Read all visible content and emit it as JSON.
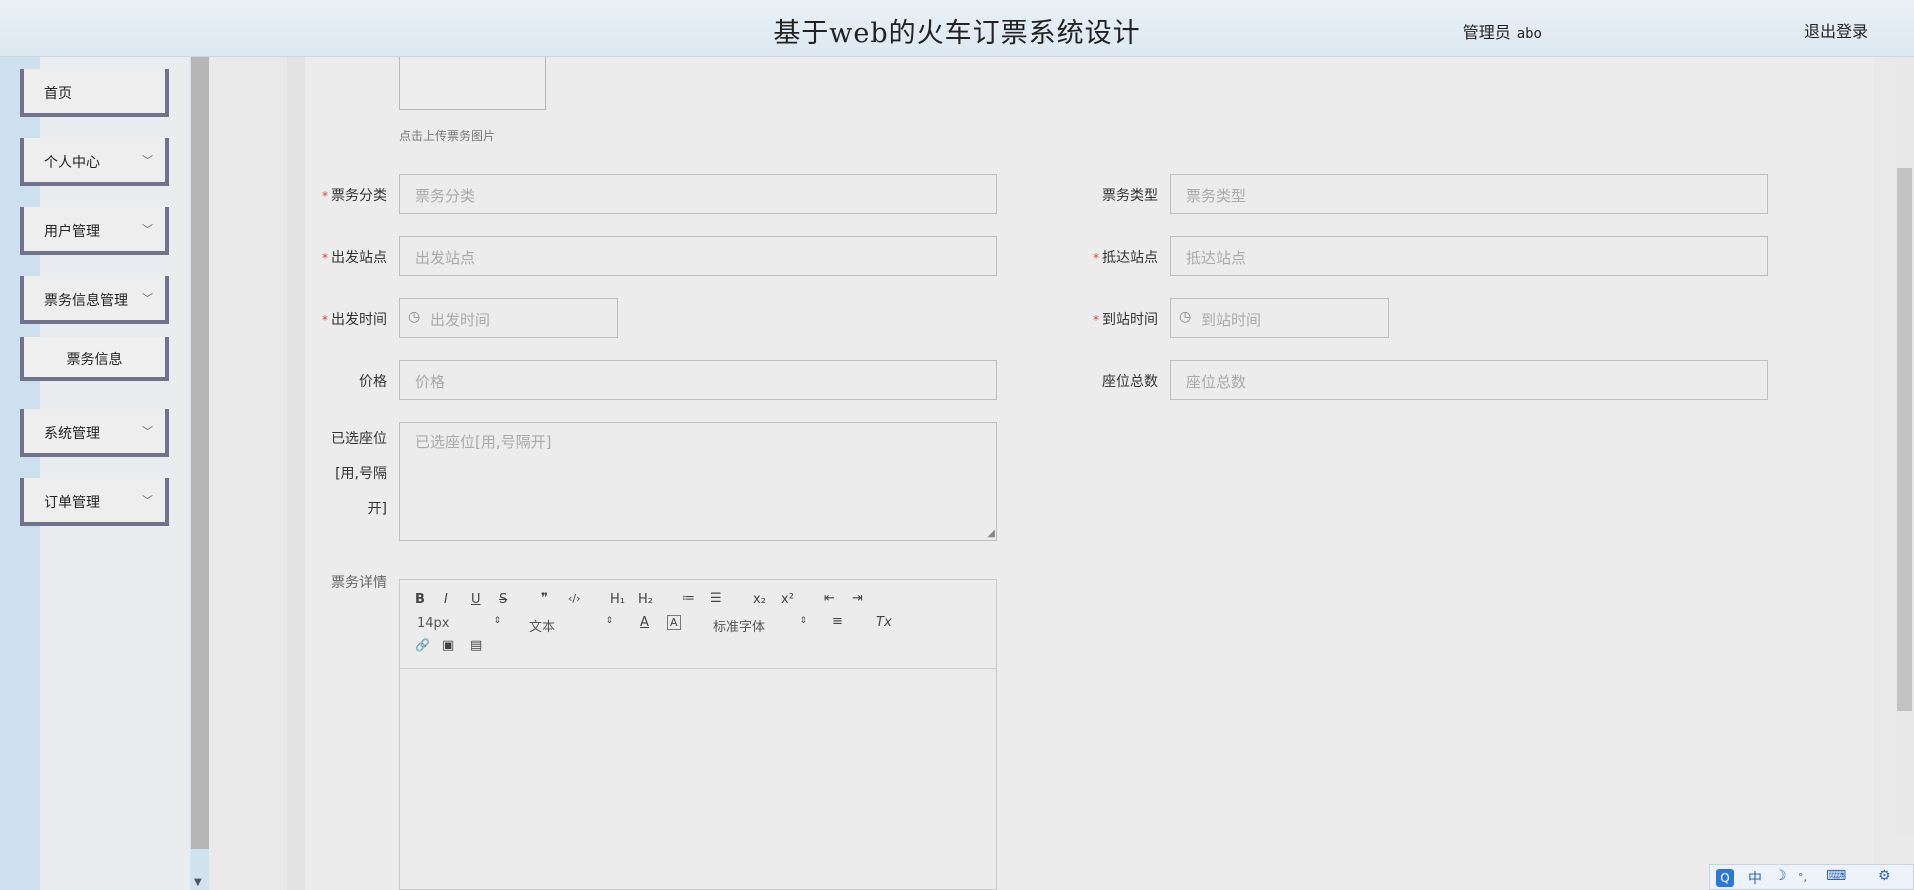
{
  "header": {
    "title": "基于web的火车订票系统设计",
    "role": "管理员",
    "username": "abo",
    "logout": "退出登录"
  },
  "sidebar": {
    "items": [
      {
        "label": "首页"
      },
      {
        "label": "个人中心",
        "chevron": "﹀"
      },
      {
        "label": "用户管理",
        "chevron": "﹀"
      },
      {
        "label": "票务信息管理",
        "chevron": "﹀"
      },
      {
        "label": "票务信息"
      },
      {
        "label": "系统管理",
        "chevron": "﹀"
      },
      {
        "label": "订单管理",
        "chevron": "﹀"
      }
    ]
  },
  "form": {
    "upload_tip": "点击上传票务图片",
    "ticket_category": {
      "label": "票务分类",
      "placeholder": "票务分类"
    },
    "ticket_type": {
      "label": "票务类型",
      "placeholder": "票务类型"
    },
    "departure_station": {
      "label": "出发站点",
      "placeholder": "出发站点"
    },
    "arrival_station": {
      "label": "抵达站点",
      "placeholder": "抵达站点"
    },
    "departure_time": {
      "label": "出发时间",
      "placeholder": "出发时间"
    },
    "arrival_time": {
      "label": "到站时间",
      "placeholder": "到站时间"
    },
    "price": {
      "label": "价格",
      "placeholder": "价格"
    },
    "total_seats": {
      "label": "座位总数",
      "placeholder": "座位总数"
    },
    "selected_seats": {
      "label_lines": [
        "已选座位",
        "[用,号隔",
        "开]"
      ],
      "placeholder": "已选座位[用,号隔开]"
    },
    "ticket_details": {
      "label": "票务详情"
    },
    "required_mark": "*"
  },
  "editor": {
    "buttons_row1": [
      "B",
      "I",
      "U",
      "S",
      "❞",
      "‹/›",
      "H₁",
      "H₂",
      "≔",
      "☰",
      "x₂",
      "x²",
      "⇤",
      "⇥"
    ],
    "font_size": "14px",
    "paragraph": "文本",
    "font_family": "标准字体",
    "align_icon": "≡",
    "clear_icon": "Tx",
    "color_icon": "A",
    "bg_icon": "A",
    "link_icon": "🔗",
    "image_icon": "▣",
    "video_icon": "▤"
  },
  "ime": {
    "logo": "Q",
    "lang": "中",
    "moon": "☽",
    "punct": "°,",
    "keyboard": "⌨",
    "tool": "⚙"
  }
}
